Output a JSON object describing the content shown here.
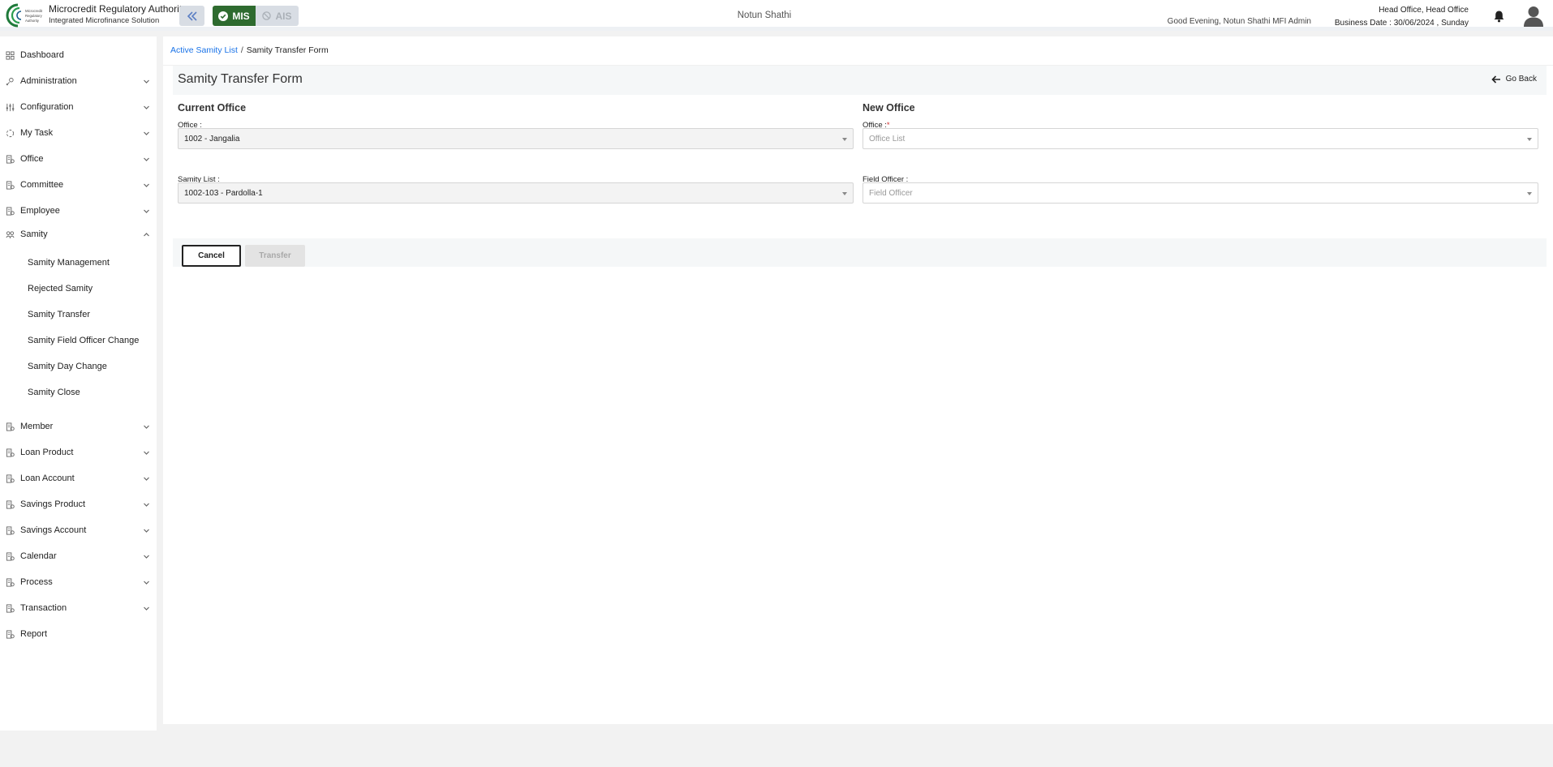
{
  "header": {
    "brand_title": "Microcredit Regulatory Authority",
    "brand_subtitle": "Integrated Microfinance Solution",
    "logo_text": "Microcredit Regulatory Authority",
    "mode_mis": "MIS",
    "mode_ais": "AIS",
    "center_title": "Notun Shathi",
    "greeting": "Good Evening, Notun Shathi MFI Admin",
    "office": "Head Office, Head Office",
    "business_date": "Business Date : 30/06/2024 , Sunday",
    "accent_color": "#2e6b2f"
  },
  "sidebar": {
    "items": [
      {
        "label": "Dashboard",
        "icon": "dashboard-icon"
      },
      {
        "label": "Administration",
        "icon": "admin-icon"
      },
      {
        "label": "Configuration",
        "icon": "sliders-icon"
      },
      {
        "label": "My Task",
        "icon": "task-icon"
      },
      {
        "label": "Office",
        "icon": "office-icon"
      },
      {
        "label": "Committee",
        "icon": "committee-icon"
      },
      {
        "label": "Employee",
        "icon": "employee-icon"
      },
      {
        "label": "Samity",
        "icon": "samity-icon"
      },
      {
        "label": "Member",
        "icon": "member-icon"
      },
      {
        "label": "Loan Product",
        "icon": "loan-product-icon"
      },
      {
        "label": "Loan Account",
        "icon": "loan-account-icon"
      },
      {
        "label": "Savings Product",
        "icon": "savings-product-icon"
      },
      {
        "label": "Savings Account",
        "icon": "savings-account-icon"
      },
      {
        "label": "Calendar",
        "icon": "calendar-icon"
      },
      {
        "label": "Process",
        "icon": "process-icon"
      },
      {
        "label": "Transaction",
        "icon": "transaction-icon"
      },
      {
        "label": "Report",
        "icon": "report-icon"
      }
    ],
    "samity_sub_items": [
      {
        "label": "Samity Management"
      },
      {
        "label": "Rejected Samity"
      },
      {
        "label": "Samity Transfer"
      },
      {
        "label": "Samity Field Officer Change"
      },
      {
        "label": "Samity Day Change"
      },
      {
        "label": "Samity Close"
      }
    ]
  },
  "breadcrumb": {
    "parent": "Active Samity List",
    "separator": "/",
    "current": "Samity Transfer Form"
  },
  "form": {
    "title": "Samity Transfer Form",
    "go_back": "Go Back",
    "current_office": {
      "heading": "Current Office",
      "office_label": "Office :",
      "office_value": "1002 - Jangalia",
      "samity_label": "Samity List :",
      "samity_value": "1002-103 - Pardolla-1"
    },
    "new_office": {
      "heading": "New Office",
      "office_label": "Office :",
      "office_required": "*",
      "office_placeholder": "Office List",
      "field_officer_label": "Field Officer :",
      "field_officer_placeholder": "Field Officer"
    },
    "cancel_label": "Cancel",
    "transfer_label": "Transfer"
  }
}
